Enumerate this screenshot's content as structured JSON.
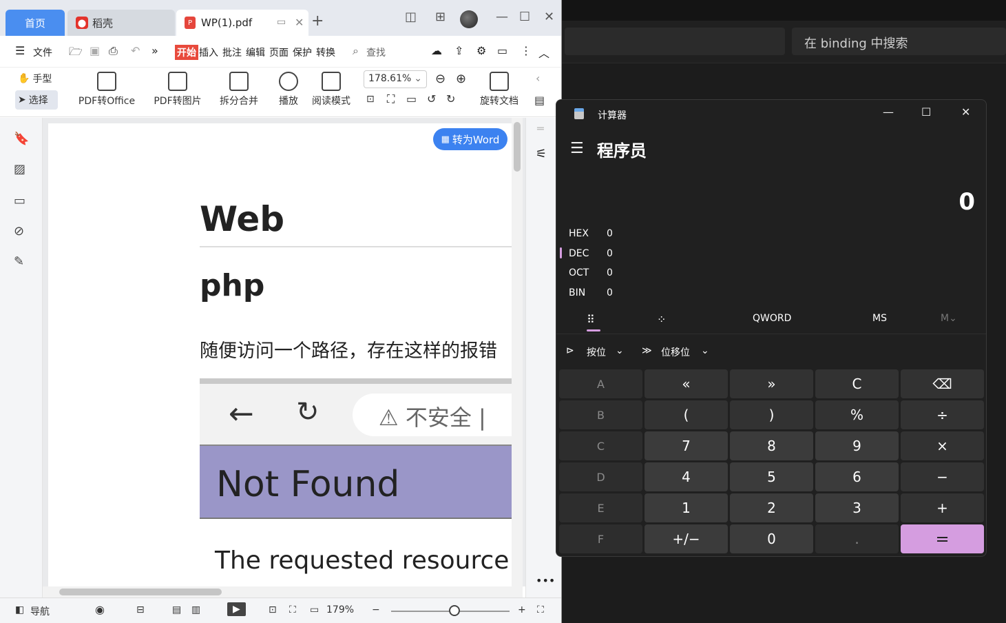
{
  "background": {
    "search_placeholder": "在 binding 中搜索"
  },
  "pdf_window": {
    "tabs": {
      "home": "首页",
      "daoke": "稻壳",
      "doc": "WP(1).pdf"
    },
    "menu": {
      "file": "文件",
      "start": "开始",
      "insert": "插入",
      "annotate": "批注",
      "edit": "编辑",
      "page": "页面",
      "protect": "保护",
      "convert": "转换",
      "find": "查找"
    },
    "toolbar": {
      "hand": "手型",
      "select": "选择",
      "pdf_to_office": "PDF转Office",
      "pdf_to_image": "PDF转图片",
      "split_merge": "拆分合并",
      "play": "播放",
      "read_mode": "阅读模式",
      "zoom": "178.61%",
      "rotate_doc": "旋转文档"
    },
    "document": {
      "to_word": "转为Word",
      "heading1": "Web",
      "heading2": "php",
      "paragraph": "随便访问一个路径，存在这样的报错",
      "screenshot": {
        "url_text": "不安全 |",
        "title": "Not Found",
        "body": "The requested resource /a"
      }
    },
    "statusbar": {
      "nav": "导航",
      "zoom": "179%"
    }
  },
  "calculator": {
    "title": "计算器",
    "mode": "程序员",
    "display": "0",
    "bases": [
      {
        "label": "HEX",
        "value": "0"
      },
      {
        "label": "DEC",
        "value": "0"
      },
      {
        "label": "OCT",
        "value": "0"
      },
      {
        "label": "BIN",
        "value": "0"
      }
    ],
    "word_size": "QWORD",
    "ms": "MS",
    "m_dropdown": "M⌄",
    "bitwise": "按位",
    "bitshift": "位移位",
    "accent_color": "#d59de0",
    "keys": [
      "A",
      "«",
      "»",
      "C",
      "⌫",
      "B",
      "(",
      ")",
      "%",
      "÷",
      "C",
      "7",
      "8",
      "9",
      "×",
      "D",
      "4",
      "5",
      "6",
      "−",
      "E",
      "1",
      "2",
      "3",
      "+",
      "F",
      "+/−",
      "0",
      ".",
      "="
    ]
  }
}
